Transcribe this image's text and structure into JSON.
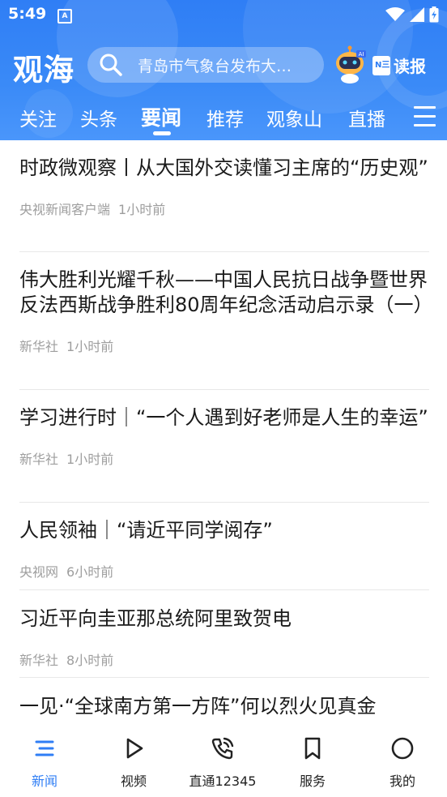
{
  "status_bar": {
    "time": "5:49",
    "notification": "A"
  },
  "app_bar": {
    "logo": "观海",
    "search_placeholder": "青岛市气象台发布大…",
    "newspaper_label": "读报",
    "newspaper_badge": "N三",
    "robot_badge": "AI"
  },
  "tabs": [
    {
      "label": "关注"
    },
    {
      "label": "头条"
    },
    {
      "label": "要闻",
      "active": true
    },
    {
      "label": "推荐"
    },
    {
      "label": "观象山"
    },
    {
      "label": "直播"
    }
  ],
  "news": [
    {
      "title": "时政微观察丨从大国外交读懂习主席的“历史观”",
      "source": "央视新闻客户端",
      "time": "1小时前"
    },
    {
      "title": "伟大胜利光耀千秋——中国人民抗日战争暨世界反法西斯战争胜利80周年纪念活动启示录（一）",
      "source": "新华社",
      "time": "1小时前"
    },
    {
      "title": "学习进行时｜“一个人遇到好老师是人生的幸运”",
      "source": "新华社",
      "time": "1小时前"
    },
    {
      "title": "人民领袖｜“请近平同学阅存”",
      "source": "央视网",
      "time": "6小时前"
    },
    {
      "title": "习近平向圭亚那总统阿里致贺电",
      "source": "新华社",
      "time": "8小时前"
    },
    {
      "title": "一见·“全球南方第一方阵”何以烈火见真金",
      "source": "",
      "time": ""
    }
  ],
  "bottom_nav": [
    {
      "label": "新闻",
      "icon": "news-list-icon",
      "active": true
    },
    {
      "label": "视频",
      "icon": "play-icon"
    },
    {
      "label": "直通12345",
      "icon": "phone-call-icon"
    },
    {
      "label": "服务",
      "icon": "bookmark-icon"
    },
    {
      "label": "我的",
      "icon": "profile-circle-icon"
    }
  ],
  "colors": {
    "brand_blue": "#2f7ef5",
    "meta_gray": "#9e9e9e"
  }
}
